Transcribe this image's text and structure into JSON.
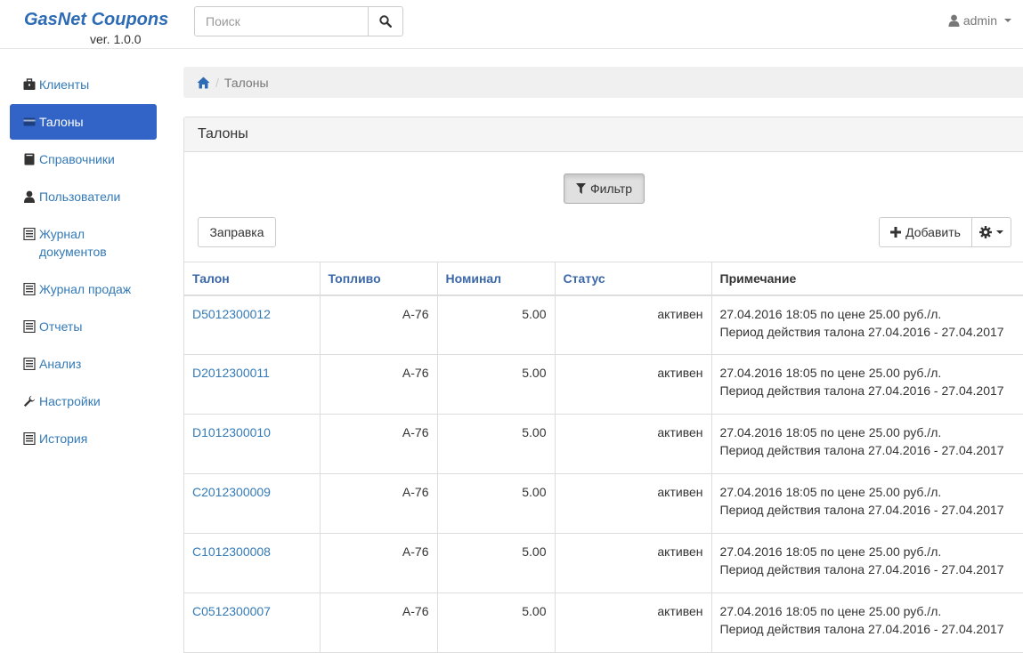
{
  "header": {
    "brand": "GasNet Coupons",
    "version": "ver. 1.0.0",
    "search_placeholder": "Поиск",
    "user": "admin"
  },
  "sidebar": {
    "items": [
      {
        "label": "Клиенты",
        "icon": "briefcase-icon"
      },
      {
        "label": "Талоны",
        "icon": "credit-card-icon",
        "active": true
      },
      {
        "label": "Справочники",
        "icon": "book-icon"
      },
      {
        "label": "Пользователи",
        "icon": "user-icon"
      },
      {
        "label": "Журнал документов",
        "icon": "list-alt-icon"
      },
      {
        "label": "Журнал продаж",
        "icon": "list-alt-icon"
      },
      {
        "label": "Отчеты",
        "icon": "list-alt-icon"
      },
      {
        "label": "Анализ",
        "icon": "list-alt-icon"
      },
      {
        "label": "Настройки",
        "icon": "wrench-icon"
      },
      {
        "label": "История",
        "icon": "list-alt-icon"
      }
    ]
  },
  "breadcrumb": {
    "current": "Талоны"
  },
  "panel": {
    "title": "Талоны",
    "filter_label": "Фильтр",
    "refuel_label": "Заправка",
    "add_label": "Добавить"
  },
  "table": {
    "columns": [
      "Талон",
      "Топливо",
      "Номинал",
      "Статус",
      "Примечание"
    ],
    "rows": [
      {
        "coupon": "D5012300012",
        "fuel": "А-76",
        "nominal": "5.00",
        "status": "активен",
        "note1": "27.04.2016 18:05 по цене 25.00 руб./л.",
        "note2": "Период действия талона 27.04.2016 - 27.04.2017"
      },
      {
        "coupon": "D2012300011",
        "fuel": "А-76",
        "nominal": "5.00",
        "status": "активен",
        "note1": "27.04.2016 18:05 по цене 25.00 руб./л.",
        "note2": "Период действия талона 27.04.2016 - 27.04.2017"
      },
      {
        "coupon": "D1012300010",
        "fuel": "А-76",
        "nominal": "5.00",
        "status": "активен",
        "note1": "27.04.2016 18:05 по цене 25.00 руб./л.",
        "note2": "Период действия талона 27.04.2016 - 27.04.2017"
      },
      {
        "coupon": "C2012300009",
        "fuel": "А-76",
        "nominal": "5.00",
        "status": "активен",
        "note1": "27.04.2016 18:05 по цене 25.00 руб./л.",
        "note2": "Период действия талона 27.04.2016 - 27.04.2017"
      },
      {
        "coupon": "C1012300008",
        "fuel": "А-76",
        "nominal": "5.00",
        "status": "активен",
        "note1": "27.04.2016 18:05 по цене 25.00 руб./л.",
        "note2": "Период действия талона 27.04.2016 - 27.04.2017"
      },
      {
        "coupon": "C0512300007",
        "fuel": "А-76",
        "nominal": "5.00",
        "status": "активен",
        "note1": "27.04.2016 18:05 по цене 25.00 руб./л.",
        "note2": "Период действия талона 27.04.2016 - 27.04.2017"
      }
    ]
  },
  "colors": {
    "brand": "#2e6bb5",
    "link": "#337ab7",
    "active_nav": "#3264c8"
  }
}
